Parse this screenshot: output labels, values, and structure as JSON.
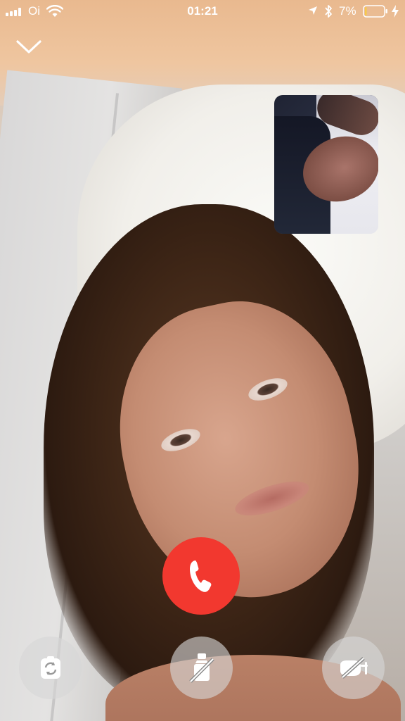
{
  "status_bar": {
    "carrier": "Oi",
    "time": "01:21",
    "battery_percent": "7%",
    "battery_level": 0.07,
    "signal_bars": 4,
    "icons": [
      "signal-icon",
      "wifi-icon",
      "location-icon",
      "bluetooth-icon",
      "battery-icon",
      "charging-icon"
    ]
  },
  "call": {
    "minimize_icon": "chevron-down-icon",
    "end_call_icon": "phone-hangup-icon",
    "controls": [
      {
        "name": "switch-camera",
        "icon": "camera-switch-icon"
      },
      {
        "name": "camera-off",
        "icon": "camera-off-icon"
      },
      {
        "name": "mute",
        "icon": "microphone-off-icon"
      }
    ]
  },
  "colors": {
    "end_call": "#f2382f",
    "control_bg": "rgba(215,215,215,0.62)",
    "icon": "#ffffff"
  }
}
